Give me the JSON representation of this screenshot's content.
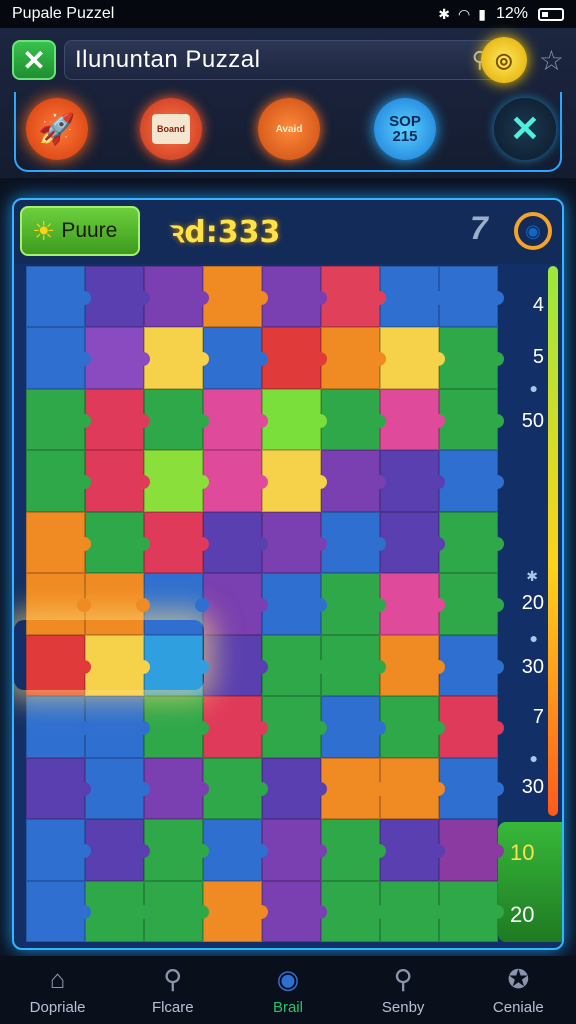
{
  "status_bar": {
    "app_name": "Pupale Puzzel",
    "battery": "12%"
  },
  "header": {
    "title": "Ilununtan Puzzal",
    "tools": {
      "board_label": "Boand",
      "hint_label": "Avaid",
      "score_top": "SOP",
      "score_value": "215"
    }
  },
  "board": {
    "pause_label": "Puure",
    "timer": "ꝛd:333",
    "level_number": "7",
    "scale_labels": [
      "4",
      "5",
      "50",
      "20",
      "30",
      "7",
      "30"
    ],
    "bonus_top": "10",
    "bonus_bottom": "20",
    "piece_colors": [
      [
        "#2f6fd0",
        "#5a3fb0",
        "#7a3fb0",
        "#f08a22",
        "#7a3fb0",
        "#e0405a",
        "#2f6fd0",
        "#2f6fd0"
      ],
      [
        "#2f6fd0",
        "#8a4ac0",
        "#f6d24a",
        "#2f6fd0",
        "#e03a3a",
        "#f08a22",
        "#f6d24a",
        "#2fa84a"
      ],
      [
        "#2fa84a",
        "#e03a5a",
        "#2fa84a",
        "#e04a9a",
        "#7adf3a",
        "#2fa84a",
        "#e04a9a",
        "#2fa84a"
      ],
      [
        "#2fa84a",
        "#e03a5a",
        "#8adf3a",
        "#e04a9a",
        "#f6d24a",
        "#7a3fb0",
        "#5a3fb0",
        "#2f6fd0"
      ],
      [
        "#f08a22",
        "#2fa84a",
        "#e03a5a",
        "#5a3fb0",
        "#7a3fb0",
        "#2f6fd0",
        "#5a3fb0",
        "#2fa84a"
      ],
      [
        "#f08a22",
        "#f08a22",
        "#2f6fd0",
        "#7a3fb0",
        "#2f6fd0",
        "#2fa84a",
        "#e04a9a",
        "#2fa84a"
      ],
      [
        "#e03a3a",
        "#f6d24a",
        "#2f9fe0",
        "#5a3fb0",
        "#2fa84a",
        "#2fa84a",
        "#f08a22",
        "#2f6fd0"
      ],
      [
        "#2f6fd0",
        "#2f6fd0",
        "#2fa84a",
        "#e03a5a",
        "#2fa84a",
        "#2f6fd0",
        "#2fa84a",
        "#e03a5a"
      ],
      [
        "#5a3fb0",
        "#2f6fd0",
        "#7a3fb0",
        "#2fa84a",
        "#5a3fb0",
        "#f08a22",
        "#f08a22",
        "#2f6fd0"
      ],
      [
        "#2f6fd0",
        "#5a3fb0",
        "#2fa84a",
        "#2f6fd0",
        "#7a3fb0",
        "#2fa84a",
        "#5a3fb0",
        "#8a3aa0"
      ],
      [
        "#2f6fd0",
        "#2fa84a",
        "#2fa84a",
        "#f08a22",
        "#7a3fb0",
        "#2fa84a",
        "#2fa84a",
        "#2fa84a"
      ]
    ]
  },
  "nav": {
    "items": [
      {
        "label": "Dopriale",
        "icon": "home-icon"
      },
      {
        "label": "Flcare",
        "icon": "search-icon"
      },
      {
        "label": "Brail",
        "icon": "circle-icon"
      },
      {
        "label": "Senby",
        "icon": "search-icon"
      },
      {
        "label": "Ceniale",
        "icon": "star-icon"
      }
    ]
  },
  "colors": {
    "accent": "#35b4ff",
    "gold": "#ffe14a",
    "green": "#38c24d"
  }
}
